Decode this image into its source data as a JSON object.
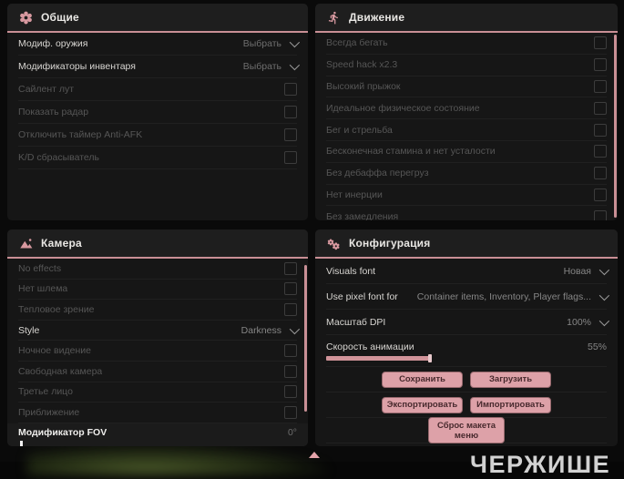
{
  "watermark": "ЧЕРЖИШЕ",
  "colors": {
    "accent": "#c98f95",
    "icon_pink": "#d899a0",
    "panel_bg": "#161616",
    "header_bg": "#1e1e1e",
    "button_bg": "#dda1a8"
  },
  "panels": {
    "general": {
      "title": "Общие",
      "icon": "gear-icon",
      "rows": [
        {
          "label": "Модиф. оружия",
          "control": "select",
          "value": "Выбрать"
        },
        {
          "label": "Модификаторы инвентаря",
          "control": "select",
          "value": "Выбрать"
        },
        {
          "label": "Сайлент лут",
          "control": "checkbox",
          "checked": false
        },
        {
          "label": "Показать радар",
          "control": "checkbox",
          "checked": false
        },
        {
          "label": "Отключить таймер Anti-AFK",
          "control": "checkbox",
          "checked": false
        },
        {
          "label": "K/D сбрасыватель",
          "control": "checkbox",
          "checked": false
        }
      ]
    },
    "movement": {
      "title": "Движение",
      "icon": "runner-icon",
      "rows": [
        {
          "label": "Всегда бегать",
          "control": "checkbox",
          "checked": false
        },
        {
          "label": "Speed hack x2.3",
          "control": "checkbox",
          "checked": false
        },
        {
          "label": "Высокий прыжок",
          "control": "checkbox",
          "checked": false
        },
        {
          "label": "Идеальное физическое состояние",
          "control": "checkbox",
          "checked": false
        },
        {
          "label": "Бег и стрельба",
          "control": "checkbox",
          "checked": false
        },
        {
          "label": "Бесконечная стамина и нет усталости",
          "control": "checkbox",
          "checked": false
        },
        {
          "label": "Без дебаффа перегруз",
          "control": "checkbox",
          "checked": false
        },
        {
          "label": "Нет инерции",
          "control": "checkbox",
          "checked": false
        },
        {
          "label": "Без замедления",
          "control": "checkbox",
          "checked": false
        }
      ]
    },
    "camera": {
      "title": "Камера",
      "icon": "image-icon",
      "rows": [
        {
          "label": "No effects",
          "control": "checkbox",
          "checked": false
        },
        {
          "label": "Нет шлема",
          "control": "checkbox",
          "checked": false
        },
        {
          "label": "Тепловое зрение",
          "control": "checkbox",
          "checked": false
        },
        {
          "label": "Style",
          "control": "select",
          "value": "Darkness"
        },
        {
          "label": "Ночное видение",
          "control": "checkbox",
          "checked": false
        },
        {
          "label": "Свободная камера",
          "control": "checkbox",
          "checked": false
        },
        {
          "label": "Третье лицо",
          "control": "checkbox",
          "checked": false
        },
        {
          "label": "Приближение",
          "control": "checkbox",
          "checked": false
        },
        {
          "label": "Модификатор FOV",
          "control": "slider",
          "value": "0°",
          "percent": 0
        }
      ]
    },
    "config": {
      "title": "Конфигурация",
      "icon": "gears-icon",
      "rows": [
        {
          "label": "Visuals font",
          "control": "select",
          "value": "Новая"
        },
        {
          "label": "Use pixel font for",
          "control": "select",
          "value": "Container items, Inventory, Player flags..."
        },
        {
          "label": "Масштаб DPI",
          "control": "select",
          "value": "100%"
        },
        {
          "label": "Скорость анимации",
          "control": "slider",
          "value": "55%",
          "percent": 55
        }
      ],
      "buttons": [
        {
          "label": "Сохранить"
        },
        {
          "label": "Загрузить"
        },
        {
          "label": "Экспортировать"
        },
        {
          "label": "Импортировать"
        }
      ],
      "reset_button": "Сброс макета меню"
    }
  }
}
